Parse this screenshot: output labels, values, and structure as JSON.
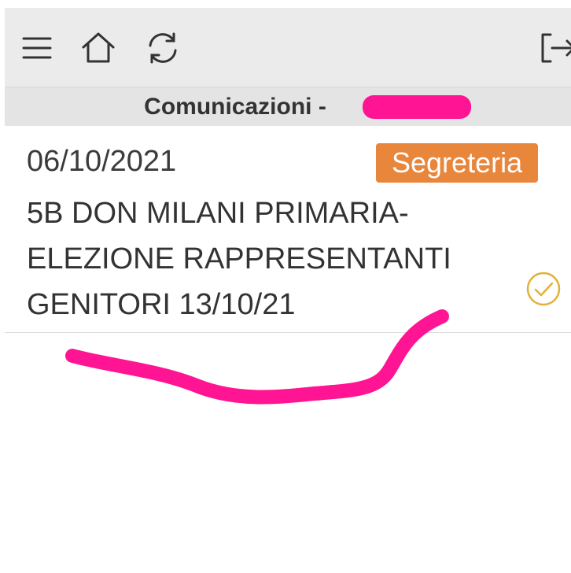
{
  "toolbar": {
    "icons": [
      "menu-icon",
      "home-icon",
      "refresh-icon",
      "logout-icon"
    ]
  },
  "subheader": {
    "title": "Comunicazioni -"
  },
  "message": {
    "date": "06/10/2021",
    "tag": "Segreteria",
    "subject": "5B DON MILANI PRIMARIA-ELEZIONE RAPPRESENTANTI GENITORI 13/10/21",
    "read_status_icon": "check-circle-icon"
  },
  "colors": {
    "toolbar_bg": "#ebebeb",
    "subheader_bg": "#e4e4e4",
    "tag_bg": "#e8863b",
    "check": "#e0b23a",
    "annotation": "#ff1493"
  }
}
